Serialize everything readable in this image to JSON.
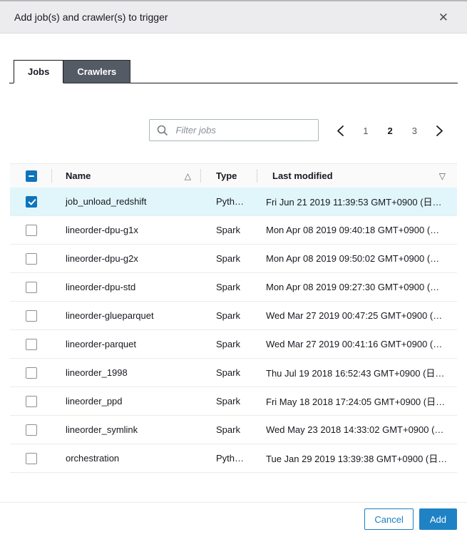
{
  "modal": {
    "title": "Add job(s) and crawler(s) to trigger"
  },
  "icons": {
    "close": "✕",
    "sort_ascending": "△",
    "column_filter": "▽"
  },
  "tabs": [
    {
      "label": "Jobs",
      "active": true
    },
    {
      "label": "Crawlers",
      "active": false
    }
  ],
  "toolbar": {
    "filter_placeholder": "Filter jobs",
    "pagination": {
      "pages": [
        "1",
        "2",
        "3"
      ],
      "current_page": "2"
    }
  },
  "table": {
    "header_checkbox_state": "indeterminate",
    "columns": [
      {
        "label": "Name"
      },
      {
        "label": "Type"
      },
      {
        "label": "Last modified"
      }
    ],
    "rows": [
      {
        "checked": true,
        "selected": true,
        "name": "job_unload_redshift",
        "type": "Pyth…",
        "last_modified": "Fri Jun 21 2019 11:39:53 GMT+0900 (日…"
      },
      {
        "checked": false,
        "selected": false,
        "name": "lineorder-dpu-g1x",
        "type": "Spark",
        "last_modified": "Mon Apr 08 2019 09:40:18 GMT+0900 (…"
      },
      {
        "checked": false,
        "selected": false,
        "name": "lineorder-dpu-g2x",
        "type": "Spark",
        "last_modified": "Mon Apr 08 2019 09:50:02 GMT+0900 (…"
      },
      {
        "checked": false,
        "selected": false,
        "name": "lineorder-dpu-std",
        "type": "Spark",
        "last_modified": "Mon Apr 08 2019 09:27:30 GMT+0900 (…"
      },
      {
        "checked": false,
        "selected": false,
        "name": "lineorder-glueparquet",
        "type": "Spark",
        "last_modified": "Wed Mar 27 2019 00:47:25 GMT+0900 (…"
      },
      {
        "checked": false,
        "selected": false,
        "name": "lineorder-parquet",
        "type": "Spark",
        "last_modified": "Wed Mar 27 2019 00:41:16 GMT+0900 (…"
      },
      {
        "checked": false,
        "selected": false,
        "name": "lineorder_1998",
        "type": "Spark",
        "last_modified": "Thu Jul 19 2018 16:52:43 GMT+0900 (日…"
      },
      {
        "checked": false,
        "selected": false,
        "name": "lineorder_ppd",
        "type": "Spark",
        "last_modified": "Fri May 18 2018 17:24:05 GMT+0900 (日…"
      },
      {
        "checked": false,
        "selected": false,
        "name": "lineorder_symlink",
        "type": "Spark",
        "last_modified": "Wed May 23 2018 14:33:02 GMT+0900 (…"
      },
      {
        "checked": false,
        "selected": false,
        "name": "orchestration",
        "type": "Pyth…",
        "last_modified": "Tue Jan 29 2019 13:39:38 GMT+0900 (日…"
      }
    ]
  },
  "footer": {
    "cancel_label": "Cancel",
    "add_label": "Add"
  },
  "colors": {
    "accent_blue": "#1f82c5",
    "checkbox_blue": "#0f74bc",
    "selected_row_bg": "#e1f6fb",
    "inactive_tab_bg": "#545b64",
    "header_bar_bg": "#ececee"
  }
}
